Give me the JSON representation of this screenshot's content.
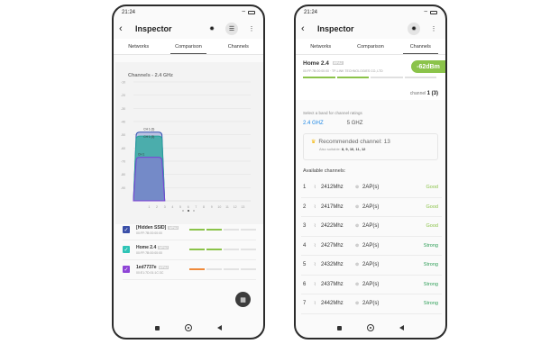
{
  "status": {
    "time": "21:24"
  },
  "left": {
    "title": "Inspector",
    "tabs": [
      "Networks",
      "Comparison",
      "Channels"
    ],
    "chart_data": {
      "type": "area",
      "title": "Channels - 2.4 GHz",
      "xlabel": "",
      "ylabel": "",
      "x": [
        1,
        2,
        3,
        4,
        5,
        6,
        7,
        8,
        9,
        10,
        11,
        12,
        13
      ],
      "ylim": [
        -100,
        -10
      ],
      "yticks": [
        -10,
        -20,
        -30,
        -40,
        -50,
        -60,
        -70,
        -80,
        -90
      ],
      "series": [
        {
          "name": "CH 1 (3)",
          "span": [
            -1,
            3
          ],
          "peak": -48,
          "color": "#2f4fb0",
          "label": "CH 1 (3)"
        },
        {
          "name": "CH 1 (3)",
          "span": [
            -1,
            3
          ],
          "peak": -51,
          "color": "#26a69a",
          "label": "CH 1 (3)"
        },
        {
          "name": "CH 1",
          "span": [
            -1,
            3
          ],
          "peak": -67,
          "color": "#7b3fd6",
          "label": "CH 1"
        }
      ],
      "grid": true
    },
    "pager": {
      "pages": 3,
      "active": 1
    },
    "networks": [
      {
        "name": "[Hidden SSID]",
        "tag": "WPA2",
        "mac": "00:FF:7B:00:00:00",
        "color": "#3a4fa8",
        "bar": [
          "#8bc34a",
          "#8bc34a",
          "#e2e2e2",
          "#e2e2e2"
        ]
      },
      {
        "name": "Home 2.4",
        "tag": "WPA2",
        "mac": "00:FF:7B:00:00:00",
        "color": "#2ec4b6",
        "bar": [
          "#8bc34a",
          "#8bc34a",
          "#e2e2e2",
          "#e2e2e2"
        ]
      },
      {
        "name": "1ed7737e",
        "tag": "WPA2",
        "mac": "00:E1:7D:01:1C:3C",
        "color": "#8e44d6",
        "bar": [
          "#f08a3a",
          "#e2e2e2",
          "#e2e2e2",
          "#e2e2e2"
        ]
      }
    ]
  },
  "right": {
    "title": "Inspector",
    "tabs": [
      "Networks",
      "Comparison",
      "Channels"
    ],
    "network": {
      "name": "Home 2.4",
      "tag": "WPA2",
      "mac": "00:FF:7B:00:00:00 · TP-LINK TECHNOLOGIES CO.,LTD",
      "dbm": "-62dBm",
      "channel_label": "channel",
      "channel_value": "1 (3)"
    },
    "band_prompt": "Select a band for channel ratings",
    "bands": [
      "2.4 GHZ",
      "5 GHZ"
    ],
    "selected_band": "2.4 GHZ",
    "recommended": {
      "label": "Recommended channel: 13",
      "also_label": "Also suitable:",
      "also_values": "8, 9, 10, 11, 12"
    },
    "available_label": "Available channels:",
    "channels": [
      {
        "num": "1",
        "freq": "2412Mhz",
        "aps": "2AP(s)",
        "rating": "Good",
        "color": "#8bc34a"
      },
      {
        "num": "2",
        "freq": "2417Mhz",
        "aps": "2AP(s)",
        "rating": "Good",
        "color": "#8bc34a"
      },
      {
        "num": "3",
        "freq": "2422Mhz",
        "aps": "2AP(s)",
        "rating": "Good",
        "color": "#8bc34a"
      },
      {
        "num": "4",
        "freq": "2427Mhz",
        "aps": "2AP(s)",
        "rating": "Strong",
        "color": "#2e9e57"
      },
      {
        "num": "5",
        "freq": "2432Mhz",
        "aps": "2AP(s)",
        "rating": "Strong",
        "color": "#2e9e57"
      },
      {
        "num": "6",
        "freq": "2437Mhz",
        "aps": "2AP(s)",
        "rating": "Strong",
        "color": "#2e9e57"
      },
      {
        "num": "7",
        "freq": "2442Mhz",
        "aps": "2AP(s)",
        "rating": "Strong",
        "color": "#2e9e57"
      }
    ]
  },
  "icons": {
    "back": "back-arrow-icon",
    "settings": "settings-icon",
    "filter": "filter-icon",
    "menu": "more-vert-icon",
    "calc": "compare-icon"
  }
}
